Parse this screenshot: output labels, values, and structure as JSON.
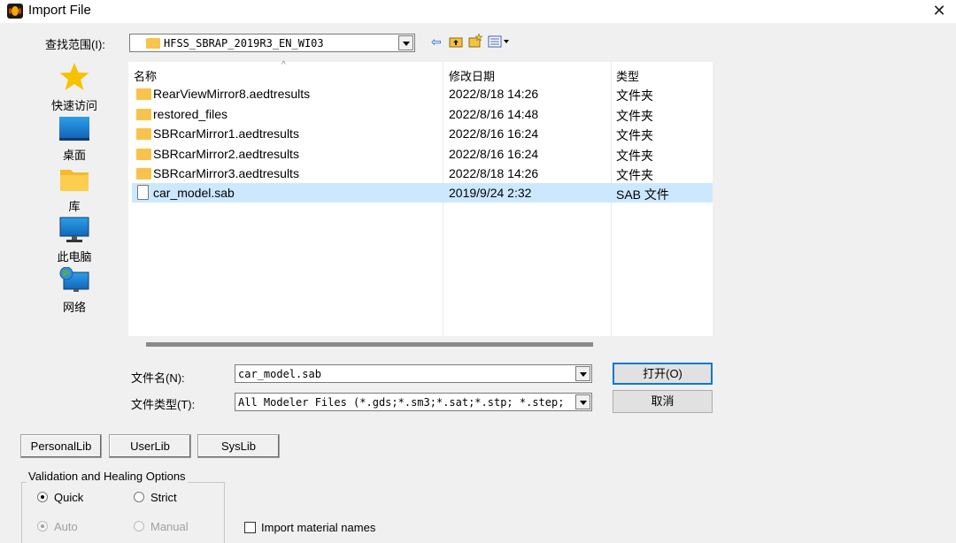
{
  "window": {
    "title": "Import File",
    "close": "✕"
  },
  "lookin": {
    "label": "查找范围(I):",
    "value": "HFSS_SBRAP_2019R3_EN_WI03"
  },
  "toolbar": {
    "back": "⇦"
  },
  "places": [
    {
      "label": "快速访问",
      "icon": "star-icon"
    },
    {
      "label": "桌面",
      "icon": "desktop-icon"
    },
    {
      "label": "库",
      "icon": "library-icon"
    },
    {
      "label": "此电脑",
      "icon": "computer-icon"
    },
    {
      "label": "网络",
      "icon": "network-icon"
    }
  ],
  "filelist": {
    "columns": [
      "名称",
      "修改日期",
      "类型"
    ],
    "rows": [
      {
        "name": "RearViewMirror8.aedtresults",
        "date": "2022/8/18 14:26",
        "type": "文件夹",
        "kind": "folder"
      },
      {
        "name": "restored_files",
        "date": "2022/8/16 14:48",
        "type": "文件夹",
        "kind": "folder"
      },
      {
        "name": "SBRcarMirror1.aedtresults",
        "date": "2022/8/16 16:24",
        "type": "文件夹",
        "kind": "folder"
      },
      {
        "name": "SBRcarMirror2.aedtresults",
        "date": "2022/8/16 16:24",
        "type": "文件夹",
        "kind": "folder"
      },
      {
        "name": "SBRcarMirror3.aedtresults",
        "date": "2022/8/18 14:26",
        "type": "文件夹",
        "kind": "folder"
      },
      {
        "name": "car_model.sab",
        "date": "2019/9/24 2:32",
        "type": "SAB 文件",
        "kind": "file",
        "selected": true
      }
    ]
  },
  "filename": {
    "label": "文件名(N):",
    "value": "car_model.sab"
  },
  "filetype": {
    "label": "文件类型(T):",
    "value": "All Modeler Files (*.gds;*.sm3;*.sat;*.stp; *.step;"
  },
  "buttons": {
    "open": "打开(O)",
    "cancel": "取消"
  },
  "libs": {
    "personal": "PersonalLib",
    "user": "UserLib",
    "sys": "SysLib"
  },
  "validation": {
    "title": "Validation and Healing Options",
    "quick": "Quick",
    "strict": "Strict",
    "auto": "Auto",
    "manual": "Manual"
  },
  "import_material": {
    "label": "Import material names",
    "checked": false
  }
}
